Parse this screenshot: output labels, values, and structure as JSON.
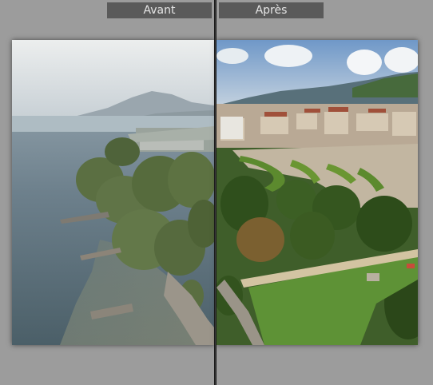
{
  "compare_view": {
    "before_label": "Avant",
    "after_label": "Après"
  },
  "colors": {
    "background": "#9c9c9c",
    "label_background": "#5a5a5a",
    "label_text": "#e6e6e6",
    "divider": "#1c1c1c"
  }
}
